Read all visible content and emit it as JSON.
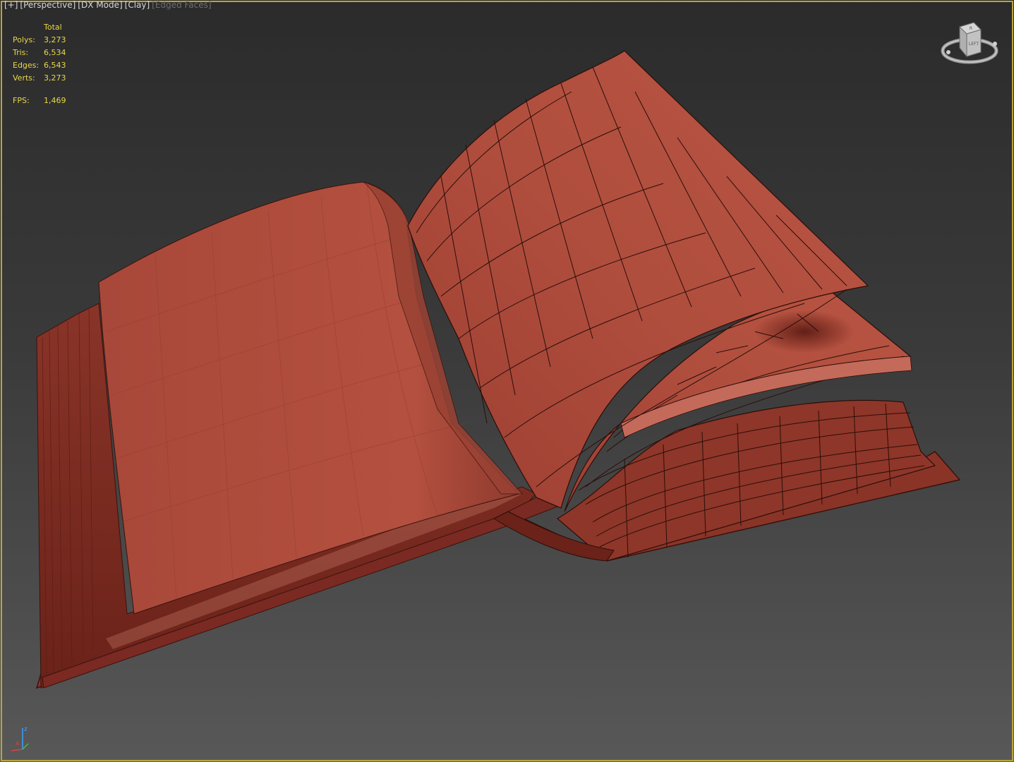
{
  "viewport": {
    "labels": [
      "[+]",
      "[Perspective]",
      "[DX Mode]",
      "[Clay]",
      "[Edged Faces]"
    ],
    "stats": {
      "header": "Total",
      "rows": [
        {
          "label": "Polys:",
          "value": "3,273"
        },
        {
          "label": "Tris:",
          "value": "6,534"
        },
        {
          "label": "Edges:",
          "value": "6,543"
        },
        {
          "label": "Verts:",
          "value": "3,273"
        }
      ],
      "fps_label": "FPS:",
      "fps_value": "1,469"
    },
    "viewcube_face": "LEFT",
    "viewcube_top": "R",
    "axis": {
      "x": "x",
      "z": "z"
    }
  },
  "colors": {
    "frame": "#b8a640",
    "stats_text": "#e8d84a",
    "clay": "#b0503f",
    "clay_dark": "#7a2a22",
    "wire": "#2a0e0a"
  },
  "icons": {
    "viewcube": "viewcube-icon",
    "axis": "axis-tripod-icon"
  }
}
